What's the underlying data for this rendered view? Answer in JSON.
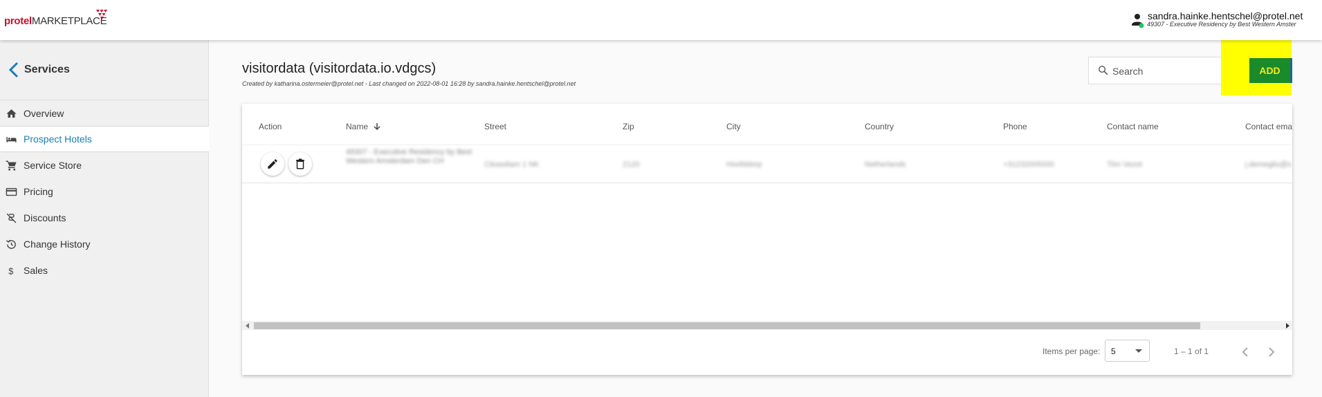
{
  "brand": {
    "part1": "protel",
    "part2": "MARKETPLACE"
  },
  "user": {
    "email": "sandra.hainke.hentschel@protel.net",
    "org": "49307 - Executive Residency by Best Western Amster",
    "status_color": "#22c55e"
  },
  "sidebar": {
    "title": "Services",
    "items": [
      {
        "label": "Overview",
        "icon": "home-icon"
      },
      {
        "label": "Prospect Hotels",
        "icon": "bed-icon",
        "active": true
      },
      {
        "label": "Service Store",
        "icon": "cart-icon"
      },
      {
        "label": "Pricing",
        "icon": "credit-card-icon"
      },
      {
        "label": "Discounts",
        "icon": "discount-off-icon"
      },
      {
        "label": "Change History",
        "icon": "history-icon"
      },
      {
        "label": "Sales",
        "icon": "dollar-icon"
      }
    ]
  },
  "header": {
    "title": "visitordata (visitordata.io.vdgcs)",
    "subtitle": "Created by katharina.ostermeier@protel.net - Last changed on 2022-08-01 16:28 by sandra.hainke.hentschel@protel.net",
    "search_placeholder": "Search",
    "add_label": "ADD"
  },
  "table": {
    "columns": [
      "Action",
      "Name",
      "Street",
      "Zip",
      "City",
      "Country",
      "Phone",
      "Contact name",
      "Contact ema"
    ],
    "rows": [
      {
        "name": "49307 - Executive Residency by Best Western Amsterdam Den CH",
        "street": "Cleasdiam 1 NK",
        "zip": "2120",
        "city": "Hoofddorp",
        "country": "Netherlands",
        "phone": "+31232005000",
        "contact_name": "Tiim Vezot",
        "contact_email": "j.demeglio@s"
      }
    ]
  },
  "paginator": {
    "label": "Items per page:",
    "value": "5",
    "range": "1 – 1 of 1"
  },
  "colors": {
    "accent": "#1a7db3",
    "add_bg": "#1a8a2a",
    "add_text": "#f5ea1a",
    "highlight": "#ffff00"
  }
}
